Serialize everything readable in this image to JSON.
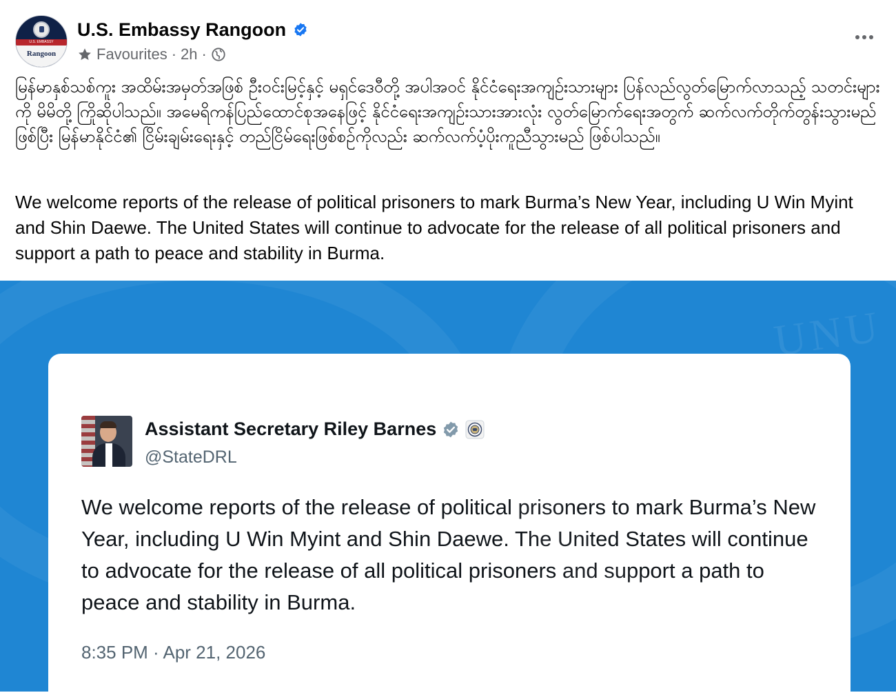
{
  "post": {
    "page_name": "U.S. Embassy Rangoon",
    "avatar": {
      "band_text": "U.S. EMBASSY",
      "bottom_text": "Rangoon"
    },
    "meta": {
      "audience": "Favourites",
      "separator1": "·",
      "time": "2h",
      "separator2": "·"
    },
    "icons": {
      "verified": "verified-badge-icon",
      "star": "star-icon",
      "globe": "globe-icon",
      "more": "more-options-icon"
    },
    "text_burmese": "မြန်မာနှစ်သစ်ကူး အထိမ်းအမှတ်အဖြစ် ဦးဝင်းမြင့်နှင့် မရှင်ဒေဝီတို့ အပါအဝင် နိုင်ငံရေးအကျဉ်းသားများ ပြန်လည်လွတ်မြောက်လာသည့် သတင်းများကို မိမိတို့ ကြိုဆိုပါသည်။ အမေရိကန်ပြည်ထောင်စုအနေဖြင့် နိုင်ငံရေးအကျဉ်းသားအားလုံး လွတ်မြောက်ရေးအတွက် ဆက်လက်တိုက်တွန်းသွားမည်ဖြစ်ပြီး မြန်မာနိုင်ငံ၏ ငြိမ်းချမ်းရေးနှင့် တည်ငြိမ်ရေးဖြစ်စဉ်ကိုလည်း ဆက်လက်ပံ့ပိုးကူညီသွားမည် ဖြစ်ပါသည်။",
    "text_english": "We welcome reports of the release of political prisoners to mark Burma’s New Year, including U Win Myint and Shin Daewe. The United States will continue to advocate for the release of all political prisoners and support a path to peace and stability in Burma."
  },
  "embedded_tweet": {
    "author_name": "Assistant Secretary Riley Barnes",
    "handle": "@StateDRL",
    "text": "We welcome reports of the release of political prisoners to mark Burma’s New Year, including U Win Myint and Shin Daewe. The United States will continue to advocate for the release of all political prisoners and support a path to peace and stability in Burma.",
    "timestamp": "8:35 PM · Apr 21, 2026",
    "icons": {
      "verified": "gray-verified-badge-icon",
      "affiliation": "state-department-seal-icon"
    }
  },
  "colors": {
    "media_background": "#1f86d3",
    "verified_blue": "#1877f2",
    "meta_gray": "#65676b",
    "tweet_gray": "#536471"
  }
}
